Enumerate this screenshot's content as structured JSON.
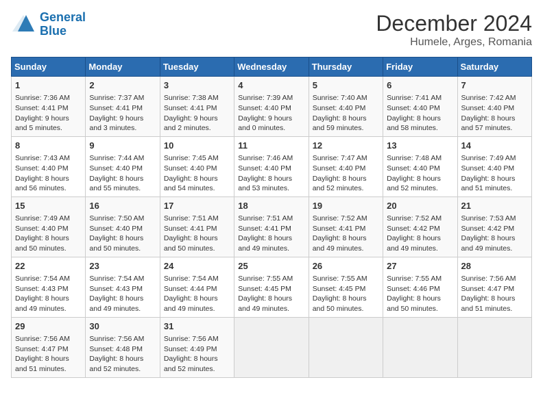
{
  "logo": {
    "line1": "General",
    "line2": "Blue"
  },
  "title": "December 2024",
  "location": "Humele, Arges, Romania",
  "days_of_week": [
    "Sunday",
    "Monday",
    "Tuesday",
    "Wednesday",
    "Thursday",
    "Friday",
    "Saturday"
  ],
  "weeks": [
    [
      {
        "day": "1",
        "info": "Sunrise: 7:36 AM\nSunset: 4:41 PM\nDaylight: 9 hours\nand 5 minutes."
      },
      {
        "day": "2",
        "info": "Sunrise: 7:37 AM\nSunset: 4:41 PM\nDaylight: 9 hours\nand 3 minutes."
      },
      {
        "day": "3",
        "info": "Sunrise: 7:38 AM\nSunset: 4:41 PM\nDaylight: 9 hours\nand 2 minutes."
      },
      {
        "day": "4",
        "info": "Sunrise: 7:39 AM\nSunset: 4:40 PM\nDaylight: 9 hours\nand 0 minutes."
      },
      {
        "day": "5",
        "info": "Sunrise: 7:40 AM\nSunset: 4:40 PM\nDaylight: 8 hours\nand 59 minutes."
      },
      {
        "day": "6",
        "info": "Sunrise: 7:41 AM\nSunset: 4:40 PM\nDaylight: 8 hours\nand 58 minutes."
      },
      {
        "day": "7",
        "info": "Sunrise: 7:42 AM\nSunset: 4:40 PM\nDaylight: 8 hours\nand 57 minutes."
      }
    ],
    [
      {
        "day": "8",
        "info": "Sunrise: 7:43 AM\nSunset: 4:40 PM\nDaylight: 8 hours\nand 56 minutes."
      },
      {
        "day": "9",
        "info": "Sunrise: 7:44 AM\nSunset: 4:40 PM\nDaylight: 8 hours\nand 55 minutes."
      },
      {
        "day": "10",
        "info": "Sunrise: 7:45 AM\nSunset: 4:40 PM\nDaylight: 8 hours\nand 54 minutes."
      },
      {
        "day": "11",
        "info": "Sunrise: 7:46 AM\nSunset: 4:40 PM\nDaylight: 8 hours\nand 53 minutes."
      },
      {
        "day": "12",
        "info": "Sunrise: 7:47 AM\nSunset: 4:40 PM\nDaylight: 8 hours\nand 52 minutes."
      },
      {
        "day": "13",
        "info": "Sunrise: 7:48 AM\nSunset: 4:40 PM\nDaylight: 8 hours\nand 52 minutes."
      },
      {
        "day": "14",
        "info": "Sunrise: 7:49 AM\nSunset: 4:40 PM\nDaylight: 8 hours\nand 51 minutes."
      }
    ],
    [
      {
        "day": "15",
        "info": "Sunrise: 7:49 AM\nSunset: 4:40 PM\nDaylight: 8 hours\nand 50 minutes."
      },
      {
        "day": "16",
        "info": "Sunrise: 7:50 AM\nSunset: 4:40 PM\nDaylight: 8 hours\nand 50 minutes."
      },
      {
        "day": "17",
        "info": "Sunrise: 7:51 AM\nSunset: 4:41 PM\nDaylight: 8 hours\nand 50 minutes."
      },
      {
        "day": "18",
        "info": "Sunrise: 7:51 AM\nSunset: 4:41 PM\nDaylight: 8 hours\nand 49 minutes."
      },
      {
        "day": "19",
        "info": "Sunrise: 7:52 AM\nSunset: 4:41 PM\nDaylight: 8 hours\nand 49 minutes."
      },
      {
        "day": "20",
        "info": "Sunrise: 7:52 AM\nSunset: 4:42 PM\nDaylight: 8 hours\nand 49 minutes."
      },
      {
        "day": "21",
        "info": "Sunrise: 7:53 AM\nSunset: 4:42 PM\nDaylight: 8 hours\nand 49 minutes."
      }
    ],
    [
      {
        "day": "22",
        "info": "Sunrise: 7:54 AM\nSunset: 4:43 PM\nDaylight: 8 hours\nand 49 minutes."
      },
      {
        "day": "23",
        "info": "Sunrise: 7:54 AM\nSunset: 4:43 PM\nDaylight: 8 hours\nand 49 minutes."
      },
      {
        "day": "24",
        "info": "Sunrise: 7:54 AM\nSunset: 4:44 PM\nDaylight: 8 hours\nand 49 minutes."
      },
      {
        "day": "25",
        "info": "Sunrise: 7:55 AM\nSunset: 4:45 PM\nDaylight: 8 hours\nand 49 minutes."
      },
      {
        "day": "26",
        "info": "Sunrise: 7:55 AM\nSunset: 4:45 PM\nDaylight: 8 hours\nand 50 minutes."
      },
      {
        "day": "27",
        "info": "Sunrise: 7:55 AM\nSunset: 4:46 PM\nDaylight: 8 hours\nand 50 minutes."
      },
      {
        "day": "28",
        "info": "Sunrise: 7:56 AM\nSunset: 4:47 PM\nDaylight: 8 hours\nand 51 minutes."
      }
    ],
    [
      {
        "day": "29",
        "info": "Sunrise: 7:56 AM\nSunset: 4:47 PM\nDaylight: 8 hours\nand 51 minutes."
      },
      {
        "day": "30",
        "info": "Sunrise: 7:56 AM\nSunset: 4:48 PM\nDaylight: 8 hours\nand 52 minutes."
      },
      {
        "day": "31",
        "info": "Sunrise: 7:56 AM\nSunset: 4:49 PM\nDaylight: 8 hours\nand 52 minutes."
      },
      null,
      null,
      null,
      null
    ]
  ]
}
